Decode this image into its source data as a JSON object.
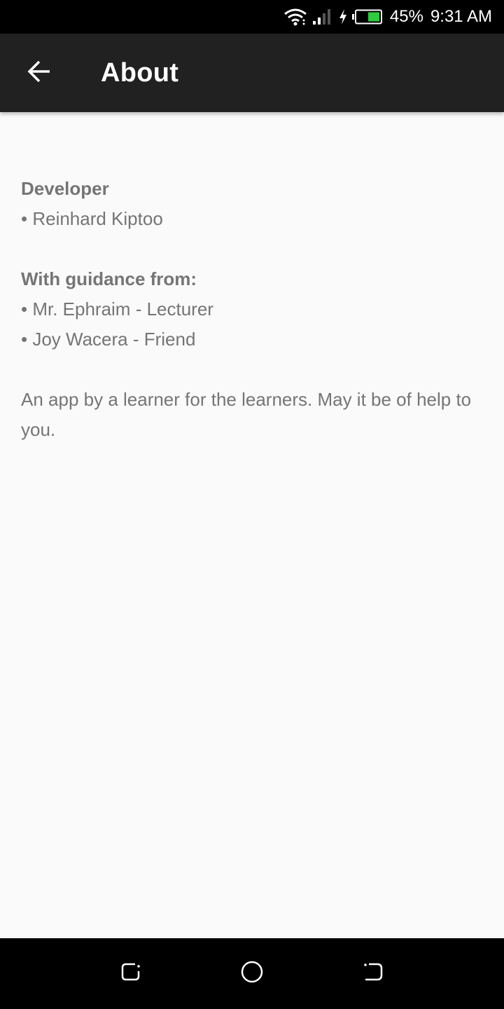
{
  "status_bar": {
    "battery_percent": "45%",
    "time": "9:31 AM",
    "icons": [
      "wifi-icon",
      "signal-icon",
      "charging-bolt-icon",
      "battery-icon"
    ],
    "battery_color": "#2ecc40"
  },
  "app_bar": {
    "title": "About",
    "back_icon": "arrow-left-icon"
  },
  "content": {
    "developer_heading": "Developer",
    "developer_name": "• Reinhard Kiptoo",
    "guidance_heading": "With guidance from:",
    "guidance_items": [
      "• Mr. Ephraim - Lecturer",
      "• Joy Wacera - Friend"
    ],
    "tagline": "An app by a learner for the learners. May it be of help to you."
  },
  "nav_bar": {
    "icons": [
      "recent-apps-icon",
      "home-icon",
      "back-nav-icon"
    ]
  },
  "colors": {
    "app_bar": "#212121",
    "background": "#fafafa",
    "text": "#757575"
  }
}
